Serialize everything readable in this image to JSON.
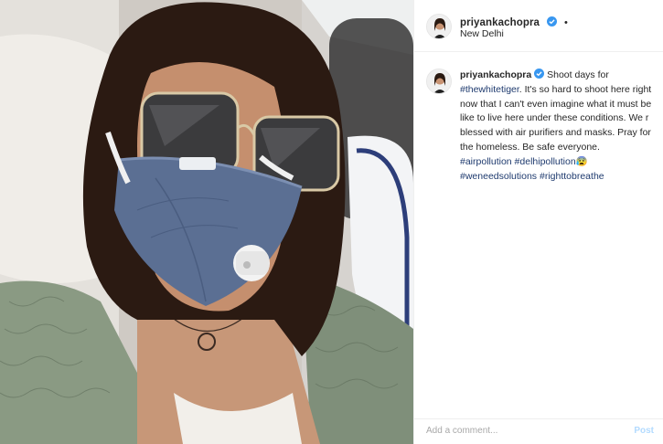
{
  "post": {
    "username": "priyankachopra",
    "location": "New Delhi",
    "header_dot": "•",
    "caption": {
      "username": "priyankachopra",
      "text_1": " Shoot days for ",
      "tag_1": "#thewhitetiger",
      "text_2": ". It's so hard to shoot here right now that I can't even imagine what it must be like to live here under these conditions. We r blessed with air purifiers and masks. Pray for the homeless. Be safe everyone. ",
      "tag_2": "#airpollution",
      "tag_3": "#delhipollution",
      "emoji": "😰",
      "tag_4": "#weneedsolutions",
      "tag_5": "#righttobreathe"
    }
  },
  "comment_box": {
    "placeholder": "Add a comment...",
    "post_label": "Post"
  },
  "icons": {
    "verified": "verified-badge-icon",
    "avatar": "profile-avatar"
  },
  "colors": {
    "hashtag": "#1e3a6e",
    "verified": "#3897f0",
    "post_disabled": "#b3dbff"
  }
}
